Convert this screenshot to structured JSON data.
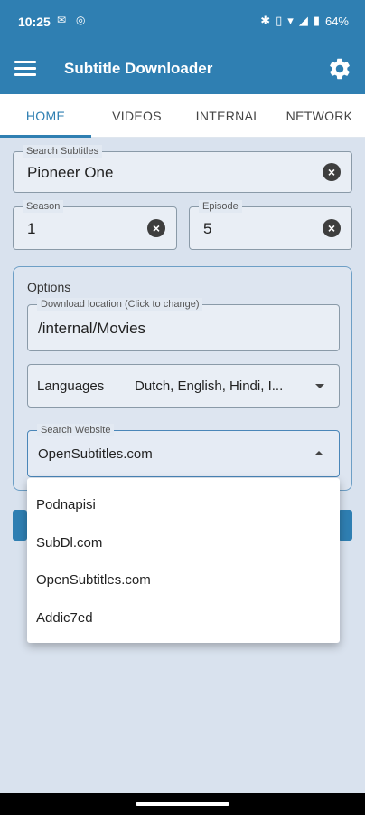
{
  "status_bar": {
    "time": "10:25",
    "battery": "64%"
  },
  "app": {
    "title": "Subtitle Downloader"
  },
  "tabs": [
    {
      "label": "HOME",
      "active": true
    },
    {
      "label": "VIDEOS",
      "active": false
    },
    {
      "label": "INTERNAL",
      "active": false
    },
    {
      "label": "NETWORK",
      "active": false
    }
  ],
  "search": {
    "label": "Search Subtitles",
    "value": "Pioneer One"
  },
  "season": {
    "label": "Season",
    "value": "1"
  },
  "episode": {
    "label": "Episode",
    "value": "5"
  },
  "options": {
    "title": "Options",
    "download_location": {
      "label": "Download location (Click to change)",
      "value": "/internal/Movies"
    },
    "languages": {
      "label": "Languages",
      "value": "Dutch, English, Hindi, I..."
    },
    "search_website": {
      "label": "Search Website",
      "value": "OpenSubtitles.com"
    }
  },
  "dropdown": {
    "items": [
      "Podnapisi",
      "SubDl.com",
      "OpenSubtitles.com",
      "Addic7ed"
    ]
  },
  "colors": {
    "primary": "#2f7fb2",
    "background": "#d9e2ee"
  }
}
